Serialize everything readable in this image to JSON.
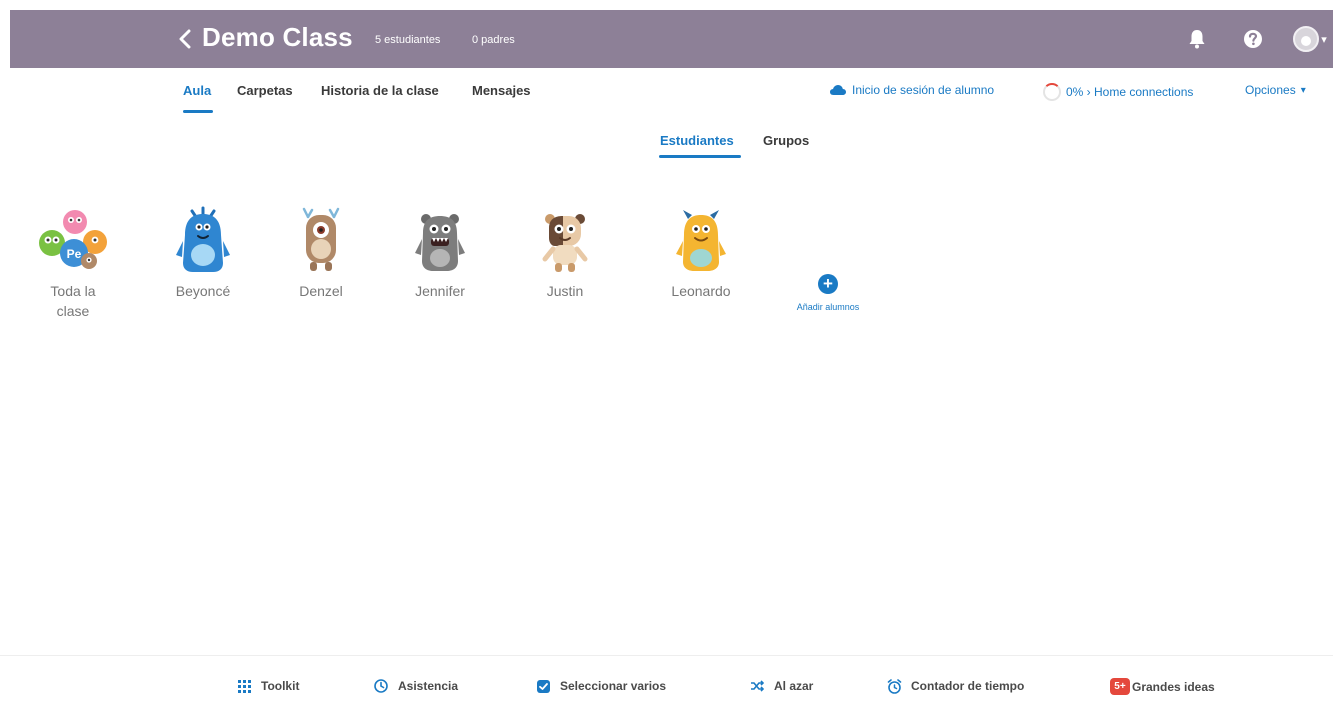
{
  "header": {
    "class_name": "Demo Class",
    "students_count": "5 estudiantes",
    "parents_count": "0 padres"
  },
  "nav": {
    "tabs": [
      {
        "label": "Aula",
        "active": true
      },
      {
        "label": "Carpetas"
      },
      {
        "label": "Historia de la clase"
      },
      {
        "label": "Mensajes"
      }
    ],
    "student_login": "Inicio de sesión de alumno",
    "home_connections": "0% › Home connections",
    "options": "Opciones"
  },
  "subtabs": [
    {
      "label": "Estudiantes",
      "active": true
    },
    {
      "label": "Grupos"
    }
  ],
  "students": [
    {
      "name": "Toda la clase",
      "icon": "whole-class-monsters-icon"
    },
    {
      "name": "Beyoncé",
      "icon": "blue-monster-icon",
      "color": "#2f86d1"
    },
    {
      "name": "Denzel",
      "icon": "brown-one-eyed-monster-icon",
      "color": "#b08968"
    },
    {
      "name": "Jennifer",
      "icon": "gray-monster-icon",
      "color": "#7d7d7d"
    },
    {
      "name": "Justin",
      "icon": "patched-monster-icon",
      "color": "#e8c9a6"
    },
    {
      "name": "Leonardo",
      "icon": "yellow-monster-icon",
      "color": "#f4b531"
    }
  ],
  "add_students": "Añadir alumnos",
  "toolbar": [
    {
      "label": "Toolkit",
      "icon": "grid-icon"
    },
    {
      "label": "Asistencia",
      "icon": "clock-icon"
    },
    {
      "label": "Seleccionar varios",
      "icon": "checkbox-icon"
    },
    {
      "label": "Al azar",
      "icon": "shuffle-icon"
    },
    {
      "label": "Contador de tiempo",
      "icon": "alarm-icon"
    },
    {
      "label": "Grandes ideas",
      "icon": "big-ideas-icon",
      "badge": "5+"
    }
  ],
  "colors": {
    "header_bg": "#8d8097",
    "accent": "#1a7ac4",
    "badge": "#e4483c"
  }
}
